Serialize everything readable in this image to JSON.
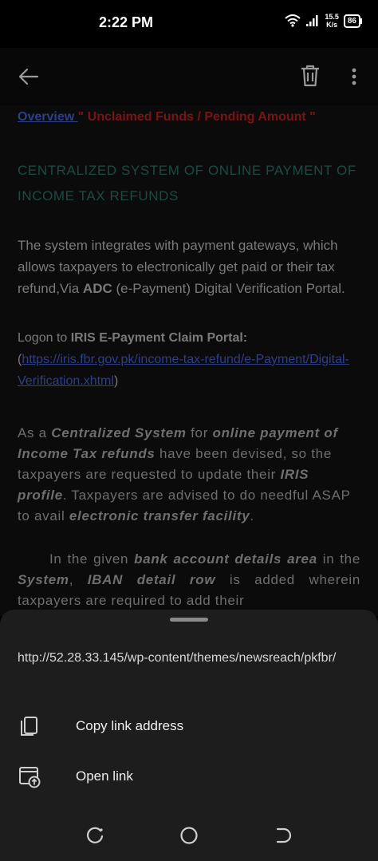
{
  "status_bar": {
    "time": "2:22 PM",
    "net_speed_value": "15.5",
    "net_speed_unit": "K/s",
    "battery": "86"
  },
  "app_bar": {
    "back_icon": "arrow-left-icon",
    "delete_icon": "trash-icon",
    "more_icon": "more-vertical-icon"
  },
  "content": {
    "overview_link": "Overview ",
    "overview_red": " \" Unclaimed Funds / Pending Amount \"",
    "heading": "CENTRALIZED SYSTEM OF ONLINE PAYMENT OF INCOME TAX REFUNDS",
    "para1_a": "The system integrates with payment gateways, which allows taxpayers to electronically get paid or their tax refund,Via ",
    "para1_b": "ADC",
    "para1_c": " (e-Payment) Digital Verification Portal.",
    "para2_a": "Logon to ",
    "para2_b": "IRIS E-Payment Claim Portal:",
    "para2_c": " (",
    "para2_link": "https://iris.fbr.gov.pk/income-tax-refund/e-Payment/Digital-Verification.xhtml",
    "para2_d": ")",
    "para3_a": "As a ",
    "para3_b": "Centralized System",
    "para3_c": " for ",
    "para3_d": "online payment of Income Tax refunds",
    "para3_e": " have been devised, so the taxpayers are requested to update their ",
    "para3_f": "IRIS profile",
    "para3_g": ". Taxpayers are advised to do needful ASAP to avail ",
    "para3_h": "electronic transfer facility",
    "para3_i": ".",
    "para4_a": "In the given ",
    "para4_b": "bank account details area",
    "para4_c": " in the ",
    "para4_d": "System",
    "para4_e": ", ",
    "para4_f": "IBAN detail row",
    "para4_g": " is added wherein taxpayers are required to add their"
  },
  "sheet": {
    "url": "http://52.28.33.145/wp-content/themes/newsreach/pkfbr/",
    "items": [
      {
        "label": "Copy link address",
        "icon": "copy-icon"
      },
      {
        "label": "Open link",
        "icon": "open-link-icon"
      }
    ]
  },
  "nav_bar": {
    "recents_icon": "recents-icon",
    "home_icon": "home-icon",
    "back_icon": "back-nav-icon"
  }
}
